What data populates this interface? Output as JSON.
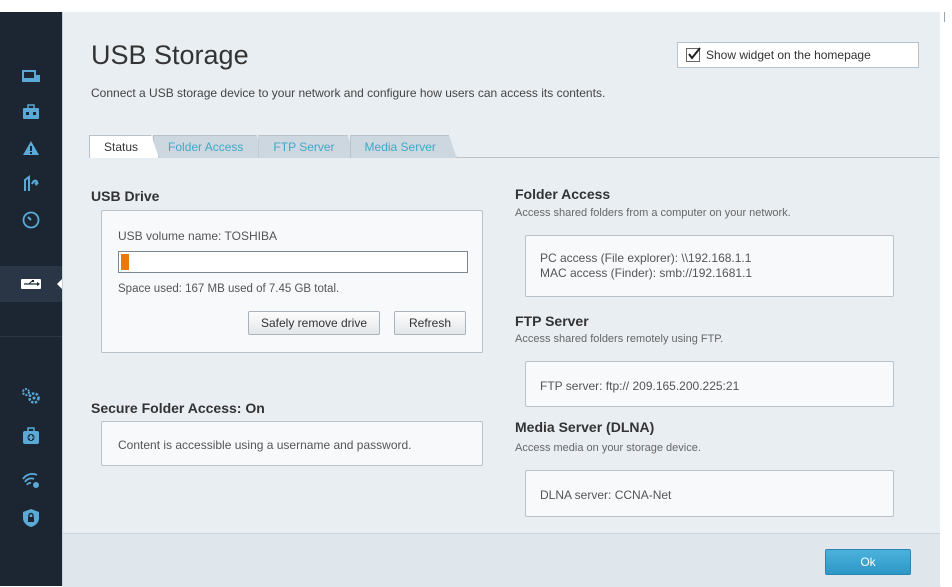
{
  "page": {
    "title": "USB Storage",
    "subtitle": "Connect a USB storage device to your network and configure how users can access its contents.",
    "widget_label": "Show widget on the homepage",
    "widget_checked": true
  },
  "sidebar": {
    "items": [
      {
        "icon": "devices-icon"
      },
      {
        "icon": "toolbox-icon"
      },
      {
        "icon": "warning-icon"
      },
      {
        "icon": "parental-controls-icon"
      },
      {
        "icon": "speed-gauge-icon"
      },
      {
        "icon": "usb-icon",
        "active": true
      },
      {
        "icon": "settings-gears-icon"
      },
      {
        "icon": "troubleshooting-icon"
      },
      {
        "icon": "wireless-icon"
      },
      {
        "icon": "security-shield-icon"
      }
    ]
  },
  "tabs": [
    {
      "label": "Status",
      "active": true
    },
    {
      "label": "Folder Access"
    },
    {
      "label": "FTP Server"
    },
    {
      "label": "Media Server"
    }
  ],
  "usb_drive": {
    "title": "USB Drive",
    "volume_name": "USB volume name: TOSHIBA",
    "space_used": "Space used: 167 MB used of 7.45 GB total.",
    "usage_fraction": 0.022,
    "remove_button": "Safely remove drive",
    "refresh_button": "Refresh"
  },
  "secure_access": {
    "title": "Secure Folder Access: On",
    "text": "Content is accessible using a username and password."
  },
  "folder_access": {
    "title": "Folder Access",
    "description": "Access shared folders from a computer on your network.",
    "pc_access": "PC access (File explorer): \\\\192.168.1.1",
    "mac_access": "MAC access (Finder): smb://192.1681.1"
  },
  "ftp_server": {
    "title": "FTP Server",
    "description": "Access shared folders remotely using FTP.",
    "address": "FTP server: ftp:// 209.165.200.225:21"
  },
  "media_server": {
    "title": "Media Server (DLNA)",
    "description": "Access media on your storage device.",
    "dlna": "DLNA server: CCNA-Net"
  },
  "footer": {
    "ok_label": "Ok"
  },
  "colors": {
    "accent": "#3fa9c8",
    "sidebar_bg": "#1c2633",
    "progress_fill": "#e8790e",
    "ok_button": "#3aa3d1"
  }
}
